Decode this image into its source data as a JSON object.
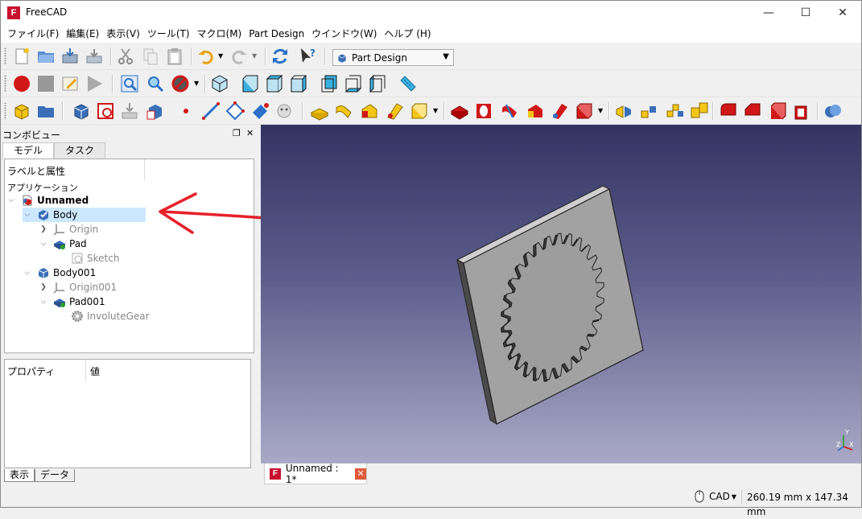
{
  "window": {
    "title": "FreeCAD",
    "icon": "freecad-logo"
  },
  "menu": [
    "ファイル(F)",
    "編集(E)",
    "表示(V)",
    "ツール(T)",
    "マクロ(M)",
    "Part Design",
    "ウインドウ(W)",
    "ヘルプ (H)"
  ],
  "workbench": {
    "selected": "Part Design"
  },
  "combo": {
    "title": "コンボビュー",
    "tabs": [
      "モデル",
      "タスク"
    ],
    "tree_header": "ラベルと属性",
    "app_label": "アプリケーション",
    "tree": [
      {
        "label": "Unnamed",
        "icon": "document-icon"
      },
      {
        "label": "Body",
        "icon": "body-active-icon"
      },
      {
        "label": "Origin",
        "icon": "origin-icon"
      },
      {
        "label": "Pad",
        "icon": "pad-icon"
      },
      {
        "label": "Sketch",
        "icon": "sketch-icon"
      },
      {
        "label": "Body001",
        "icon": "body-icon"
      },
      {
        "label": "Origin001",
        "icon": "origin-icon"
      },
      {
        "label": "Pad001",
        "icon": "pad-icon"
      },
      {
        "label": "InvoluteGear",
        "icon": "gear-icon"
      }
    ],
    "property_headers": [
      "プロパティ",
      "値"
    ],
    "bottom_tabs": [
      "表示",
      "データ"
    ]
  },
  "document_tab": {
    "label": "Unnamed : 1*"
  },
  "status": {
    "navigation_style": "CAD",
    "dimensions": "260.19 mm x 147.34 mm"
  },
  "colors": {
    "selection": "#cce8ff",
    "annotation_arrow": "#e8202a",
    "viewport_top": "#343463",
    "viewport_bottom": "#a9a9c6"
  }
}
